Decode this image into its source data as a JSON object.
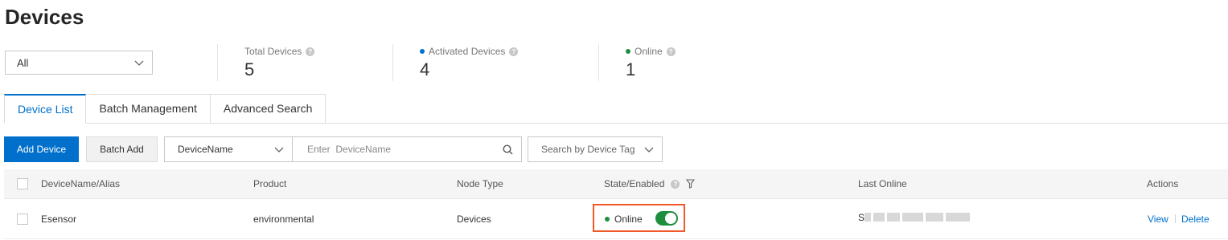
{
  "page": {
    "title": "Devices"
  },
  "product_filter": {
    "selected": "All"
  },
  "stats": [
    {
      "label": "Total Devices",
      "value": "5",
      "dot_color": ""
    },
    {
      "label": "Activated Devices",
      "value": "4",
      "dot_color": "#0070cc"
    },
    {
      "label": "Online",
      "value": "1",
      "dot_color": "#1e8e3e"
    }
  ],
  "tabs": [
    {
      "label": "Device List",
      "active": true
    },
    {
      "label": "Batch Management",
      "active": false
    },
    {
      "label": "Advanced Search",
      "active": false
    }
  ],
  "toolbar": {
    "add_device_label": "Add Device",
    "batch_add_label": "Batch Add",
    "search_field": "DeviceName",
    "search_placeholder": "Enter  DeviceName",
    "tag_search_placeholder": "Search by Device Tag"
  },
  "table": {
    "columns": {
      "name": "DeviceName/Alias",
      "product": "Product",
      "node_type": "Node Type",
      "state": "State/Enabled",
      "last_online": "Last Online",
      "actions": "Actions"
    },
    "rows": [
      {
        "name": "Esensor",
        "product": "environmental",
        "node_type": "Devices",
        "state": "Online",
        "enabled": true,
        "last_online": "S",
        "actions": [
          "View",
          "Delete"
        ]
      }
    ]
  },
  "colors": {
    "primary": "#0070cc",
    "online_green": "#1e8e3e",
    "highlight_orange": "#f05a28"
  },
  "icons": {
    "help": "question-mark-circle-icon",
    "filter": "funnel-icon",
    "search": "magnifier-icon",
    "dropdown": "chevron-down-icon"
  }
}
